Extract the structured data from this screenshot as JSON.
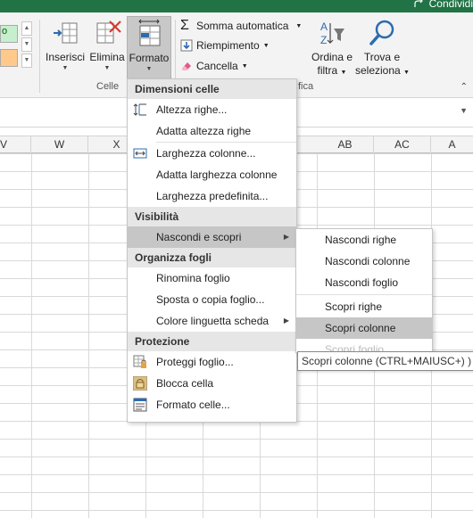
{
  "titlebar": {
    "share_label": "Condividi"
  },
  "ribbon": {
    "styles": {
      "good_label": "o"
    },
    "cells_group": {
      "insert": "Inserisci",
      "delete": "Elimina",
      "format": "Formato",
      "group_label": "Celle"
    },
    "editing_group": {
      "autosum": "Somma automatica",
      "fill": "Riempimento",
      "clear": "Cancella",
      "sort_line1": "Ordina e",
      "sort_line2": "filtra",
      "find_line1": "Trova e",
      "find_line2": "seleziona",
      "group_label_partial": "fica"
    }
  },
  "grid": {
    "columns": [
      "V",
      "W",
      "X",
      "AB",
      "AC",
      "A"
    ]
  },
  "format_menu": {
    "sections": [
      {
        "header": "Dimensioni celle",
        "items": [
          {
            "label": "Altezza righe...",
            "icon": "row-height-icon"
          },
          {
            "label": "Adatta altezza righe"
          },
          {
            "label": "Larghezza colonne...",
            "icon": "column-width-icon"
          },
          {
            "label": "Adatta larghezza colonne"
          },
          {
            "label": "Larghezza predefinita..."
          }
        ]
      },
      {
        "header": "Visibilità",
        "items": [
          {
            "label": "Nascondi e scopri",
            "submenu": true,
            "highlighted": true
          }
        ]
      },
      {
        "header": "Organizza fogli",
        "items": [
          {
            "label": "Rinomina foglio"
          },
          {
            "label": "Sposta o copia foglio..."
          },
          {
            "label": "Colore linguetta scheda",
            "submenu": true
          }
        ]
      },
      {
        "header": "Protezione",
        "items": [
          {
            "label": "Proteggi foglio...",
            "icon": "protect-sheet-icon"
          },
          {
            "label": "Blocca cella",
            "icon": "lock-cell-icon"
          },
          {
            "label": "Formato celle...",
            "icon": "format-cells-icon"
          }
        ]
      }
    ]
  },
  "submenu": {
    "items": [
      "Nascondi righe",
      "Nascondi colonne",
      "Nascondi foglio",
      "Scopri righe",
      "Scopri colonne",
      "Scopri foglio"
    ],
    "highlighted_index": 4
  },
  "tooltip": {
    "text": "Scopri colonne (CTRL+MAIUSC+) )"
  },
  "colors": {
    "title_green": "#217346",
    "menu_highlight": "#c6c6c6",
    "section_header_bg": "#e6e6e6",
    "good_style_bg": "#c6efce",
    "orange_style_bg": "#ffc98b"
  }
}
